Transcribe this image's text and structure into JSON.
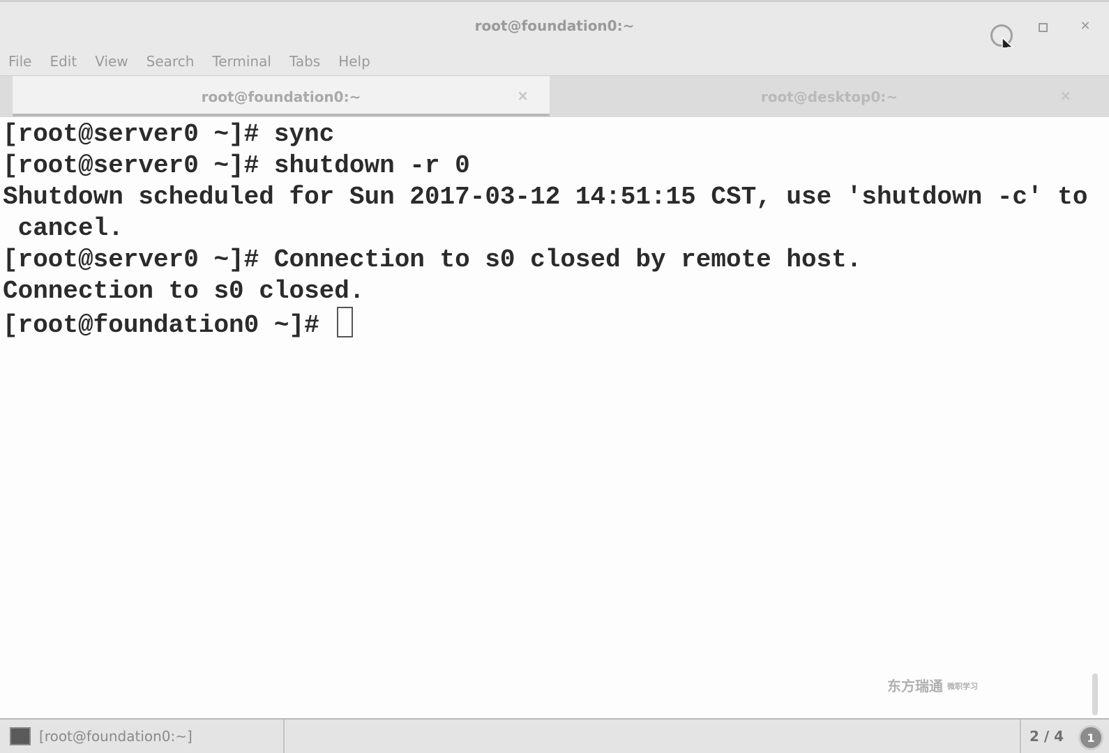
{
  "window": {
    "title": "root@foundation0:~"
  },
  "menu": [
    "File",
    "Edit",
    "View",
    "Search",
    "Terminal",
    "Tabs",
    "Help"
  ],
  "tabs": [
    {
      "label": "root@foundation0:~",
      "close": "×"
    },
    {
      "label": "root@desktop0:~",
      "close": "×"
    }
  ],
  "terminal": {
    "lines": [
      "[root@server0 ~]# sync",
      "[root@server0 ~]# shutdown -r 0",
      "Shutdown scheduled for Sun 2017-03-12 14:51:15 CST, use 'shutdown -c' to",
      " cancel.",
      "[root@server0 ~]# Connection to s0 closed by remote host.",
      "Connection to s0 closed.",
      "[root@foundation0 ~]# "
    ]
  },
  "watermark": {
    "text": "东方瑞通",
    "small": "微职学习"
  },
  "taskbar": {
    "task_label": "[root@foundation0:~]",
    "workspace": "2 / 4",
    "notification_count": "1"
  },
  "icons": {
    "minimize": "minimize-icon",
    "maximize": "maximize-icon",
    "close": "close-icon",
    "terminal": "terminal-icon"
  },
  "colors": {
    "chrome": "#e9e9e9",
    "terminal_bg": "#fdfdfd",
    "terminal_text": "#2b2b2b"
  }
}
